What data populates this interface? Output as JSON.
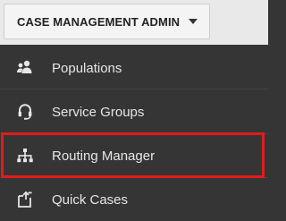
{
  "header": {
    "admin_menu_label": "CASE MANAGEMENT ADMIN"
  },
  "menu": {
    "items": [
      {
        "label": "Populations",
        "icon": "users-icon"
      },
      {
        "label": "Service Groups",
        "icon": "headset-icon",
        "highlighted": true
      },
      {
        "label": "Routing Manager",
        "icon": "sitemap-icon"
      },
      {
        "label": "Quick Cases",
        "icon": "quick-case-icon"
      }
    ]
  },
  "colors": {
    "menu_background": "#353535",
    "menu_text": "#e6e6e6",
    "highlight_border": "#e31b1b",
    "header_background": "#e9e9e9"
  }
}
